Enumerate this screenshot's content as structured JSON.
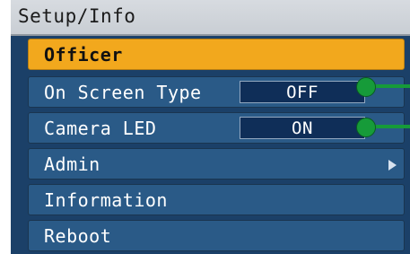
{
  "header": {
    "title": "Setup/Info"
  },
  "menu": {
    "items": [
      {
        "label": "Officer",
        "selected": true
      },
      {
        "label": "On Screen Type",
        "value": "OFF"
      },
      {
        "label": "Camera LED",
        "value": "ON"
      },
      {
        "label": "Admin",
        "has_submenu": true
      },
      {
        "label": "Information"
      },
      {
        "label": "Reboot"
      }
    ]
  },
  "colors": {
    "background": "#1b4068",
    "item": "#2a5a87",
    "selected": "#f2a81d",
    "value_box": "#0f2e58",
    "callout": "#169b39"
  },
  "icons": {
    "submenu": "chevron-right-icon",
    "callout": "callout-dot-icon"
  }
}
